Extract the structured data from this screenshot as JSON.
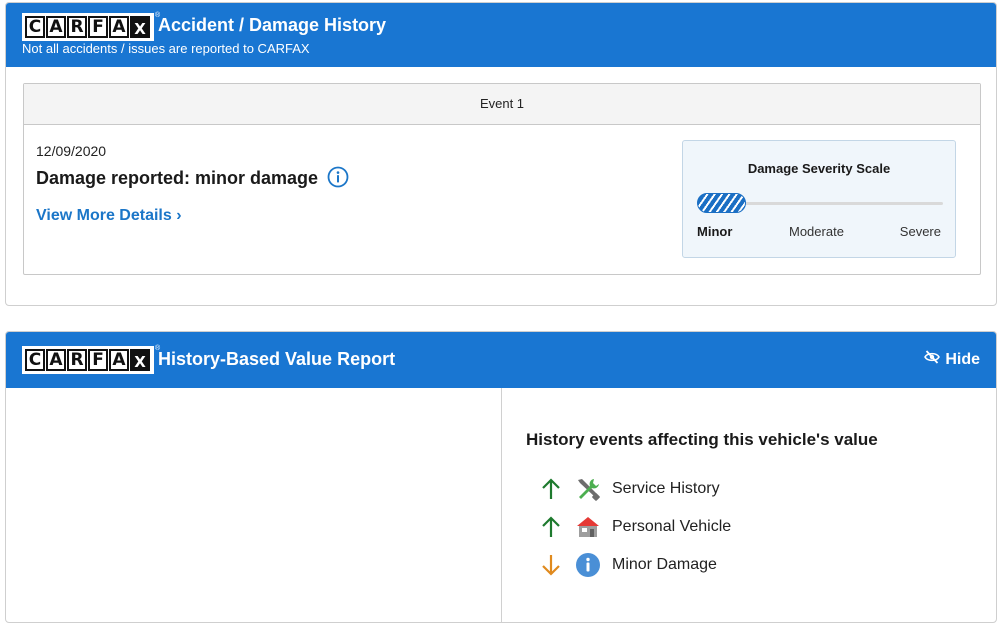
{
  "brand": {
    "letters": [
      "C",
      "A",
      "R",
      "F",
      "A",
      "X"
    ],
    "tm": "®"
  },
  "accident": {
    "title": "Accident / Damage History",
    "subtitle": "Not all accidents / issues are reported to CARFAX",
    "event": {
      "header": "Event 1",
      "date": "12/09/2020",
      "title": "Damage reported: minor damage",
      "link": "View More Details ›"
    },
    "severity": {
      "title": "Damage Severity Scale",
      "labels": [
        "Minor",
        "Moderate",
        "Severe"
      ],
      "selected": "Minor",
      "level_fraction": 0.2
    }
  },
  "value_report": {
    "title": "History-Based Value Report",
    "hide_label": "Hide",
    "events_title": "History events affecting this vehicle's value",
    "events": [
      {
        "label": "Service History",
        "direction": "up",
        "icon": "tools-icon"
      },
      {
        "label": "Personal Vehicle",
        "direction": "up",
        "icon": "house-icon"
      },
      {
        "label": "Minor Damage",
        "direction": "down",
        "icon": "info-icon"
      }
    ]
  },
  "colors": {
    "header_blue": "#1976d2",
    "link_blue": "#1b76c8",
    "up_green": "#1e7a2e",
    "down_orange": "#e08a1e"
  }
}
